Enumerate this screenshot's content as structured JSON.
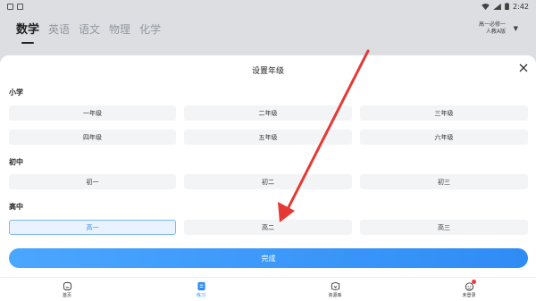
{
  "status_bar": {
    "time": "2:42"
  },
  "subject_tabs": [
    {
      "label": "数学",
      "active": true
    },
    {
      "label": "英语",
      "active": false
    },
    {
      "label": "语文",
      "active": false
    },
    {
      "label": "物理",
      "active": false
    },
    {
      "label": "化学",
      "active": false
    }
  ],
  "textbook": {
    "line1": "高一必修一",
    "line2": "人教A版"
  },
  "dialog": {
    "title": "设置年级",
    "close_icon": "close-icon",
    "sections": [
      {
        "label": "小学",
        "grades": [
          "一年级",
          "二年级",
          "三年级",
          "四年级",
          "五年级",
          "六年级"
        ]
      },
      {
        "label": "初中",
        "grades": [
          "初一",
          "初二",
          "初三"
        ]
      },
      {
        "label": "高中",
        "grades": [
          "高一",
          "高二",
          "高三"
        ]
      }
    ],
    "selected_grade": "高一",
    "done_label": "完成"
  },
  "bottom_nav": [
    {
      "label": "首页",
      "icon": "home-icon",
      "active": false
    },
    {
      "label": "练习",
      "icon": "practice-icon",
      "active": true
    },
    {
      "label": "资源库",
      "icon": "resource-icon",
      "active": false
    },
    {
      "label": "未登录",
      "icon": "user-icon",
      "active": false,
      "badge": true
    }
  ],
  "colors": {
    "accent": "#2f8cf5",
    "selected_bg": "#e8f3ff",
    "arrow": "#e53935",
    "badge": "#f5343e"
  }
}
